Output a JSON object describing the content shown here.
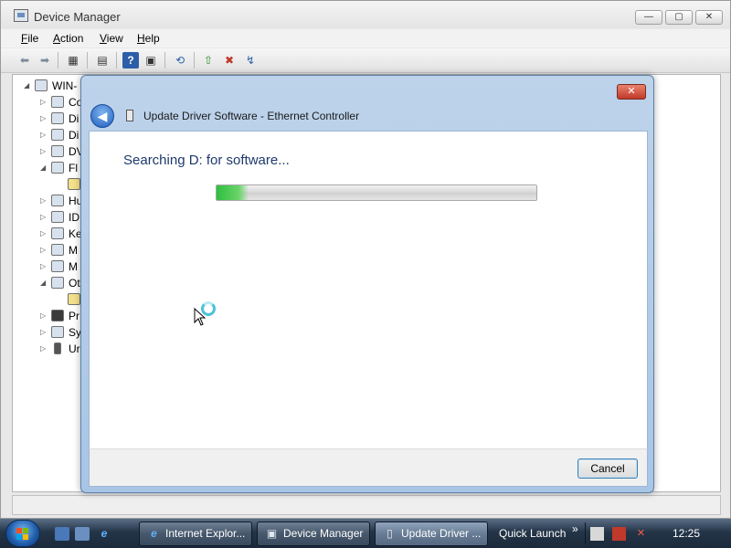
{
  "main_window": {
    "title": "Device Manager",
    "controls": {
      "minimize": "—",
      "maximize": "▢",
      "close": "✕"
    }
  },
  "menu": {
    "file": {
      "mnemonic": "F",
      "rest": "ile"
    },
    "action": {
      "mnemonic": "A",
      "rest": "ction"
    },
    "view": {
      "mnemonic": "V",
      "rest": "iew"
    },
    "help": {
      "mnemonic": "H",
      "rest": "elp"
    }
  },
  "toolbar": {
    "back_icon": "⬅",
    "forward_icon": "➡",
    "show_hide_icon": "▦",
    "properties_icon": "▤",
    "help_icon": "?",
    "console_icon": "▣",
    "scan_icon": "⟲",
    "update_icon": "⇧",
    "disable_icon": "✖",
    "uninstall_icon": "↯"
  },
  "tree": {
    "items": [
      {
        "expander": "◢",
        "label": "WIN-"
      },
      {
        "expander": "▷",
        "label": "Co"
      },
      {
        "expander": "▷",
        "label": "Di"
      },
      {
        "expander": "▷",
        "label": "Di"
      },
      {
        "expander": "▷",
        "label": "DV"
      },
      {
        "expander": "◢",
        "label": "Fl"
      },
      {
        "expander": "",
        "label": ""
      },
      {
        "expander": "▷",
        "label": "Hu"
      },
      {
        "expander": "▷",
        "label": "ID"
      },
      {
        "expander": "▷",
        "label": "Ke"
      },
      {
        "expander": "▷",
        "label": "M"
      },
      {
        "expander": "▷",
        "label": "M"
      },
      {
        "expander": "◢",
        "label": "Ot"
      },
      {
        "expander": "",
        "label": ""
      },
      {
        "expander": "▷",
        "label": "Pr"
      },
      {
        "expander": "▷",
        "label": "Sy"
      },
      {
        "expander": "▷",
        "label": "Ur"
      }
    ]
  },
  "dialog": {
    "title": "Update Driver Software - Ethernet Controller",
    "close_glyph": "✕",
    "back_glyph": "◀",
    "heading": "Searching D: for software...",
    "progress": 0.1,
    "cancel_label": "Cancel"
  },
  "taskbar": {
    "tasks": [
      {
        "label": "Internet Explor...",
        "icon": "e"
      },
      {
        "label": "Device Manager",
        "icon": "▣"
      },
      {
        "label": "Update Driver ...",
        "icon": "▯"
      }
    ],
    "quick_launch_label": "Quick Launch",
    "chevron": "»",
    "clock": "12:25"
  },
  "colors": {
    "dialog_heading": "#1e3a6b",
    "progress_green": "#2fbf3f",
    "taskbar_dark": "#1b2a3b"
  }
}
